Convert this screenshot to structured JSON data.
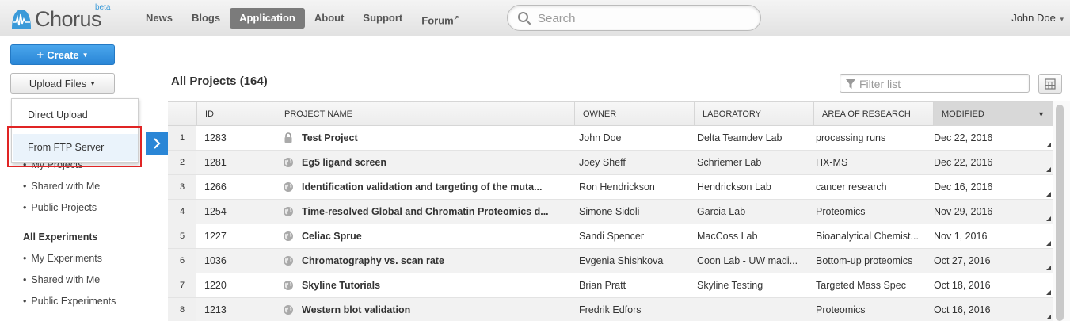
{
  "app": {
    "logo_text": "Chorus",
    "logo_badge": "beta"
  },
  "nav": {
    "items": [
      {
        "label": "News",
        "active": false
      },
      {
        "label": "Blogs",
        "active": false
      },
      {
        "label": "Application",
        "active": true
      },
      {
        "label": "About",
        "active": false
      },
      {
        "label": "Support",
        "active": false
      },
      {
        "label": "Forum",
        "active": false
      }
    ],
    "forum_external_mark": "↗"
  },
  "search": {
    "placeholder": "Search"
  },
  "user": {
    "name": "John Doe",
    "caret": "▾"
  },
  "buttons": {
    "create": "Create",
    "upload": "Upload Files"
  },
  "upload_menu": {
    "items": [
      "Direct Upload",
      "From FTP Server"
    ]
  },
  "sidebar": {
    "project_items": [
      "My Projects",
      "Shared with Me",
      "Public Projects"
    ],
    "experiments_heading": "All Experiments",
    "experiment_items": [
      "My Experiments",
      "Shared with Me",
      "Public Experiments"
    ]
  },
  "main": {
    "title": "All Projects (164)",
    "filter_placeholder": "Filter list"
  },
  "table": {
    "columns": [
      "ID",
      "PROJECT NAME",
      "OWNER",
      "LABORATORY",
      "AREA OF RESEARCH",
      "MODIFIED"
    ],
    "sort_indicator": "▼",
    "rows": [
      {
        "n": "1",
        "id": "1283",
        "icon": "lock-icon",
        "name": "Test Project",
        "owner": "John Doe",
        "lab": "Delta Teamdev Lab",
        "area": "processing runs",
        "modified": "Dec 22, 2016"
      },
      {
        "n": "2",
        "id": "1281",
        "icon": "globe-icon",
        "name": "Eg5 ligand screen",
        "owner": "Joey Sheff",
        "lab": "Schriemer Lab",
        "area": "HX-MS",
        "modified": "Dec 22, 2016"
      },
      {
        "n": "3",
        "id": "1266",
        "icon": "globe-icon",
        "name": "Identification validation and targeting of the muta...",
        "owner": "Ron Hendrickson",
        "lab": "Hendrickson Lab",
        "area": "cancer research",
        "modified": "Dec 16, 2016"
      },
      {
        "n": "4",
        "id": "1254",
        "icon": "globe-icon",
        "name": "Time-resolved Global and Chromatin Proteomics d...",
        "owner": "Simone Sidoli",
        "lab": "Garcia Lab",
        "area": "Proteomics",
        "modified": "Nov 29, 2016"
      },
      {
        "n": "5",
        "id": "1227",
        "icon": "globe-icon",
        "name": "Celiac Sprue",
        "owner": "Sandi Spencer",
        "lab": "MacCoss Lab",
        "area": "Bioanalytical Chemist...",
        "modified": "Nov 1, 2016"
      },
      {
        "n": "6",
        "id": "1036",
        "icon": "globe-icon",
        "name": "Chromatography vs. scan rate",
        "owner": "Evgenia Shishkova",
        "lab": "Coon Lab - UW madi...",
        "area": "Bottom-up proteomics",
        "modified": "Oct 27, 2016"
      },
      {
        "n": "7",
        "id": "1220",
        "icon": "globe-icon",
        "name": "Skyline Tutorials",
        "owner": "Brian Pratt",
        "lab": "Skyline Testing",
        "area": "Targeted Mass Spec",
        "modified": "Oct 18, 2016"
      },
      {
        "n": "8",
        "id": "1213",
        "icon": "globe-icon",
        "name": "Western blot validation",
        "owner": "Fredrik Edfors",
        "lab": "",
        "area": "Proteomics",
        "modified": "Oct 16, 2016"
      }
    ]
  },
  "colors": {
    "accent": "#2a86d6",
    "highlight_box": "#e02424",
    "active_nav": "#7b7b7b"
  }
}
